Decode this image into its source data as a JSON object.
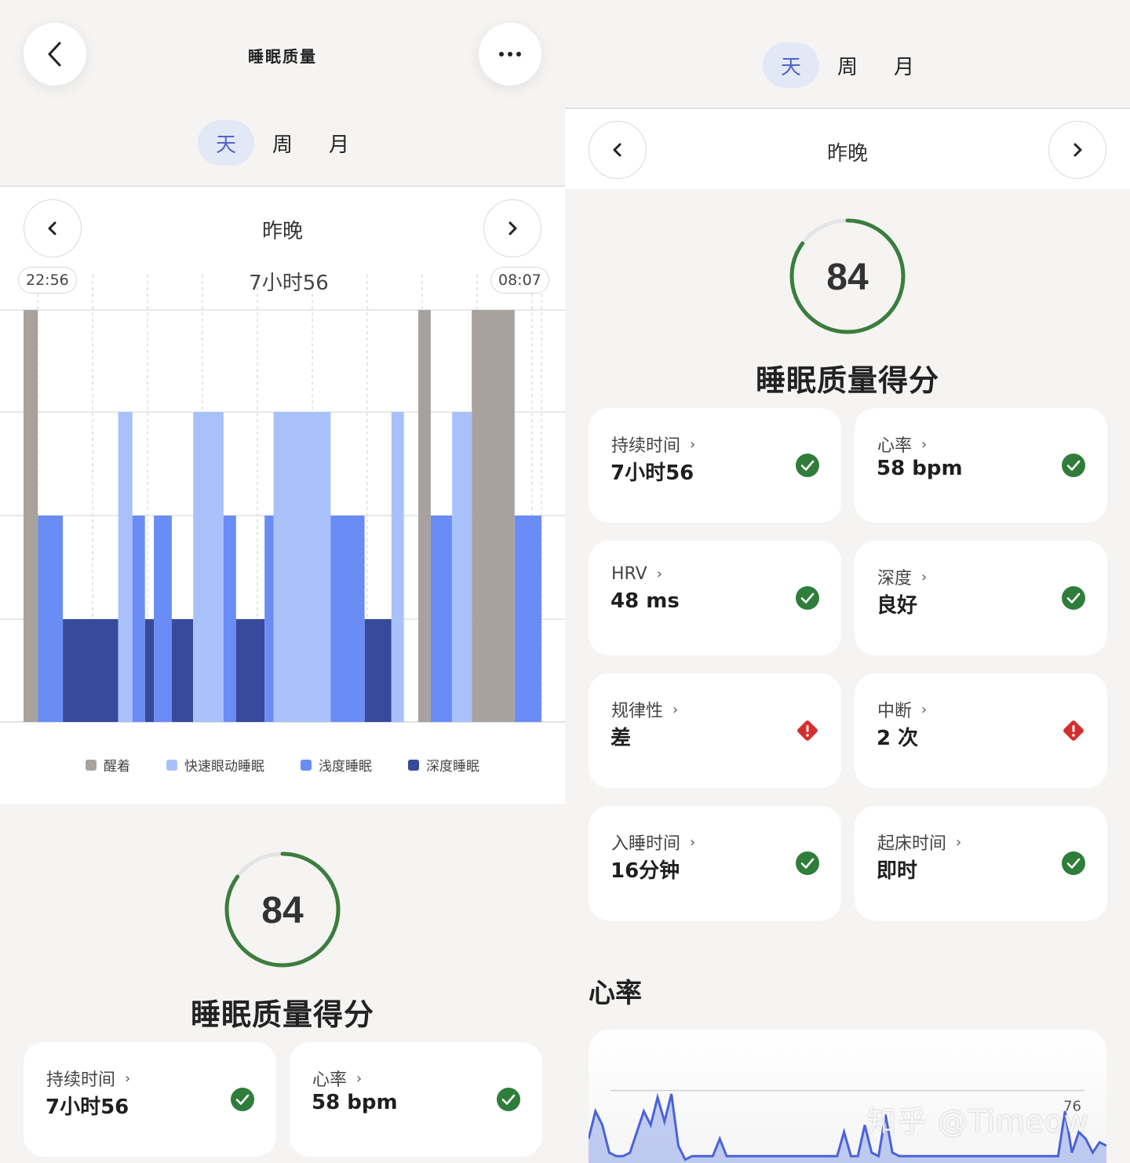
{
  "left": {
    "header": {
      "title": "睡眠质量"
    },
    "tabs": [
      {
        "label": "天",
        "active": true
      },
      {
        "label": "周",
        "active": false
      },
      {
        "label": "月",
        "active": false
      }
    ],
    "night_label": "昨晚",
    "start_time": "22:56",
    "end_time": "08:07",
    "duration": "7小时56",
    "score": {
      "value": "84",
      "fraction": 0.85,
      "title": "睡眠质量得分"
    },
    "metrics": [
      {
        "label": "持续时间",
        "value": "7小时56",
        "status": "good"
      },
      {
        "label": "心率",
        "value": "58 bpm",
        "status": "good"
      }
    ]
  },
  "right": {
    "tabs": [
      {
        "label": "天",
        "active": true
      },
      {
        "label": "周",
        "active": false
      },
      {
        "label": "月",
        "active": false
      }
    ],
    "night_label": "昨晚",
    "score": {
      "value": "84",
      "fraction": 0.85,
      "title": "睡眠质量得分"
    },
    "metrics": [
      {
        "label": "持续时间",
        "value": "7小时56",
        "status": "good"
      },
      {
        "label": "心率",
        "value": "58 bpm",
        "status": "good"
      },
      {
        "label": "HRV",
        "value": "48 ms",
        "status": "good"
      },
      {
        "label": "深度",
        "value": "良好",
        "status": "good"
      },
      {
        "label": "规律性",
        "value": "差",
        "status": "warning"
      },
      {
        "label": "中断",
        "value": "2 次",
        "status": "warning"
      },
      {
        "label": "入睡时间",
        "value": "16分钟",
        "status": "good"
      },
      {
        "label": "起床时间",
        "value": "即时",
        "status": "good"
      }
    ],
    "heart_rate_section": {
      "title": "心率",
      "axis_label": "76"
    }
  },
  "watermark": "知乎 @Timeow",
  "colors": {
    "awake": "#a7a29e",
    "rem": "#a9c1fb",
    "light": "#6a8cf5",
    "deep": "#384a9b",
    "accent": "#4f66c8",
    "ring": "#3b7d3d",
    "good": "#2f7d3a",
    "warning": "#d42f2f"
  },
  "chart_data": [
    {
      "type": "bar",
      "subtype": "hypnogram",
      "x_start": "22:56",
      "x_end": "08:07",
      "stage_levels": {
        "awake": 4,
        "rem": 3,
        "light": 2,
        "deep": 1
      },
      "legend": [
        {
          "key": "awake",
          "name": "醒着"
        },
        {
          "key": "rem",
          "name": "快速眼动睡眠"
        },
        {
          "key": "light",
          "name": "浅度睡眠"
        },
        {
          "key": "deep",
          "name": "深度睡眠"
        }
      ],
      "segments": [
        {
          "stage": "awake",
          "start_min": 0,
          "end_min": 8
        },
        {
          "stage": "light",
          "start_min": 8,
          "end_min": 22
        },
        {
          "stage": "deep",
          "start_min": 22,
          "end_min": 53
        },
        {
          "stage": "rem",
          "start_min": 53,
          "end_min": 61
        },
        {
          "stage": "light",
          "start_min": 61,
          "end_min": 68
        },
        {
          "stage": "deep",
          "start_min": 68,
          "end_min": 73
        },
        {
          "stage": "light",
          "start_min": 73,
          "end_min": 83
        },
        {
          "stage": "deep",
          "start_min": 83,
          "end_min": 95
        },
        {
          "stage": "rem",
          "start_min": 95,
          "end_min": 112
        },
        {
          "stage": "light",
          "start_min": 112,
          "end_min": 119
        },
        {
          "stage": "deep",
          "start_min": 119,
          "end_min": 135
        },
        {
          "stage": "light",
          "start_min": 135,
          "end_min": 140
        },
        {
          "stage": "rem",
          "start_min": 140,
          "end_min": 172
        },
        {
          "stage": "light",
          "start_min": 172,
          "end_min": 191
        },
        {
          "stage": "deep",
          "start_min": 191,
          "end_min": 206
        },
        {
          "stage": "rem",
          "start_min": 206,
          "end_min": 213
        },
        {
          "stage": "awake",
          "start_min": 221,
          "end_min": 228
        },
        {
          "stage": "light",
          "start_min": 228,
          "end_min": 240
        },
        {
          "stage": "rem",
          "start_min": 240,
          "end_min": 251
        },
        {
          "stage": "awake",
          "start_min": 251,
          "end_min": 275
        },
        {
          "stage": "light",
          "start_min": 275,
          "end_min": 290
        }
      ],
      "total_min": 290
    },
    {
      "type": "area",
      "title": "心率",
      "y_tick": 76,
      "values": [
        62,
        70,
        66,
        58,
        57,
        57,
        58,
        64,
        70,
        66,
        74,
        67,
        75,
        60,
        56,
        57,
        57,
        57,
        57,
        62,
        57,
        57,
        57,
        57,
        57,
        57,
        57,
        57,
        57,
        57,
        57,
        57,
        57,
        57,
        57,
        57,
        57,
        64,
        57,
        57,
        66,
        58,
        57,
        69,
        58,
        57,
        57,
        57,
        57,
        57,
        57,
        57,
        57,
        57,
        57,
        57,
        57,
        57,
        57,
        57,
        57,
        57,
        57,
        57,
        57,
        57,
        57,
        57,
        57,
        70,
        58,
        64,
        62,
        58,
        61,
        60
      ]
    }
  ]
}
